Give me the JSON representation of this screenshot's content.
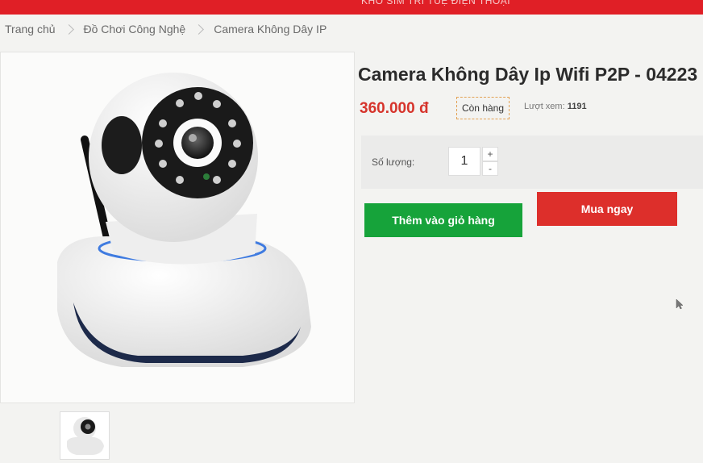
{
  "topbar": {
    "text": "KHO SIM TRÍ TUỆ ĐIỆN THOẠI"
  },
  "breadcrumb": {
    "items": [
      "Trang chủ",
      "Đồ Chơi Công Nghệ",
      "Camera Không Dây IP"
    ]
  },
  "product": {
    "title": "Camera Không Dây Ip Wifi P2P - 04223",
    "price": "360.000 đ",
    "stock_status": "Còn hàng",
    "views_label": "Lượt xem:",
    "views_count": "1191",
    "quantity_label": "Số lượng:",
    "quantity": "1",
    "plus": "+",
    "minus": "-",
    "add_to_cart": "Thêm vào giỏ hàng",
    "buy_now": "Mua ngay",
    "main_image_icon": "camera-image",
    "thumbnail_icon": "camera-thumbnail"
  },
  "colors": {
    "brand_red": "#e01f26",
    "price_red": "#d6342c",
    "cart_green": "#16a33a",
    "buy_red": "#dd2f2b",
    "stock_border": "#e3a255"
  }
}
